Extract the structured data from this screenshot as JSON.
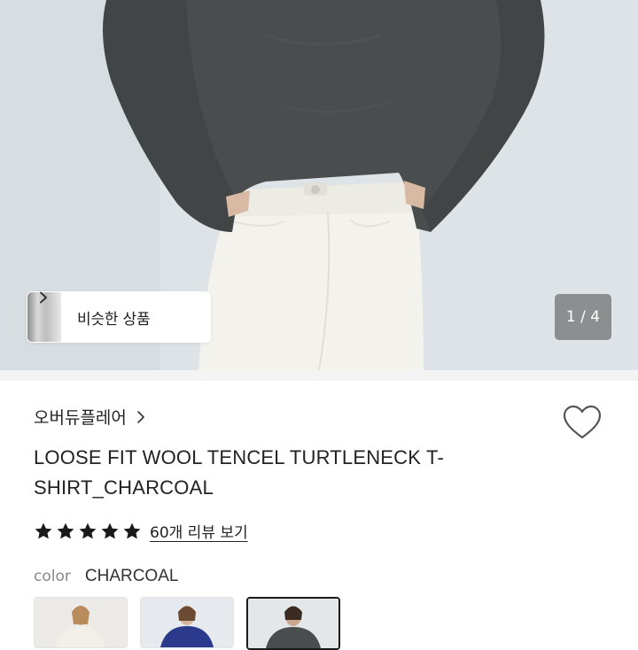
{
  "gallery": {
    "similar_label": "비슷한 상품",
    "counter": "1 / 4"
  },
  "product": {
    "brand": "오버듀플레어",
    "title": "LOOSE FIT WOOL TENCEL TURTLENECK T-SHIRT_CHARCOAL",
    "rating": 5,
    "review_link": "60개 리뷰 보기"
  },
  "options": {
    "color_label": "color",
    "color_value": "CHARCOAL",
    "swatches": [
      {
        "name": "ivory",
        "selected": false
      },
      {
        "name": "navy",
        "selected": false
      },
      {
        "name": "charcoal",
        "selected": true
      }
    ]
  },
  "colors": {
    "sweater": "#4a4d4e",
    "pants": "#f4f2ec",
    "wall": "#dde3e6",
    "star": "#1a1a1a"
  },
  "icons": [
    "chevron-right-icon",
    "heart-icon",
    "star-icon"
  ]
}
